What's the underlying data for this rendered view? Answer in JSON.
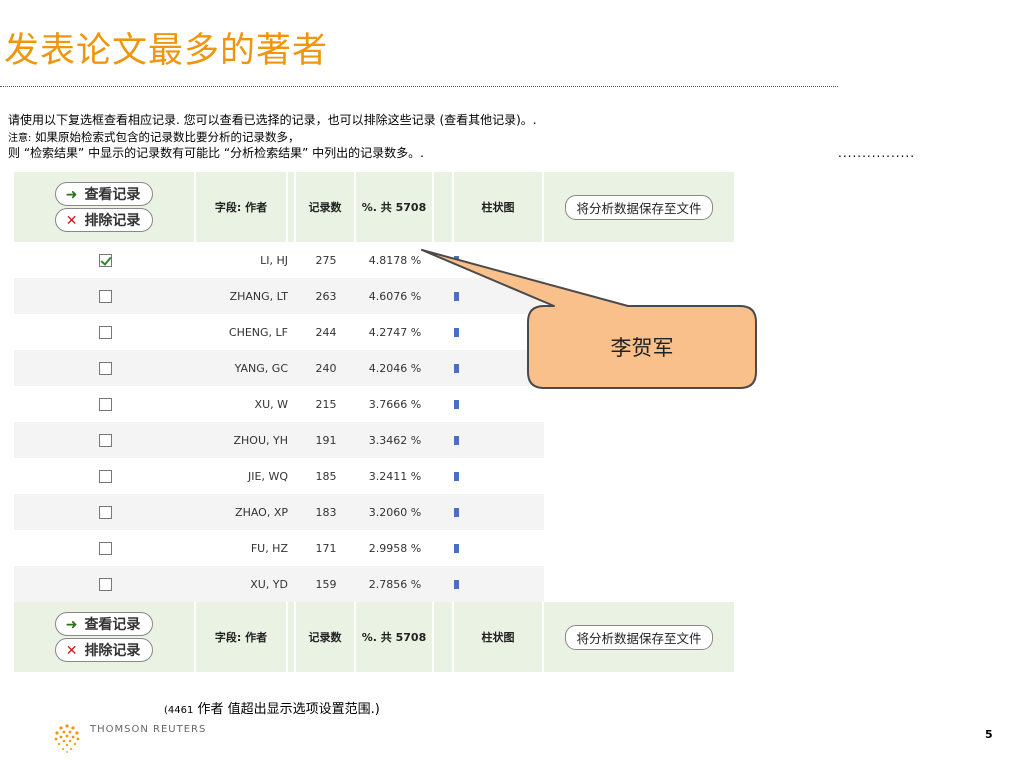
{
  "page": {
    "title": "发表论文最多的著者",
    "page_number": "5"
  },
  "instructions": {
    "line1": "请使用以下复选框查看相应记录. 您可以查看已选择的记录，也可以排除这些记录 (查看其他记录)。.",
    "line2_label": "注意:",
    "line2": "如果原始检索式包含的记录数比要分析的记录数多，",
    "line3": "则 “检索结果” 中显示的记录数有可能比 “分析检索结果” 中列出的记录数多。.",
    "trailing_dots": "................"
  },
  "table": {
    "buttons": {
      "view_label": "查看记录",
      "exclude_label": "排除记录",
      "save_label": "将分析数据保存至文件"
    },
    "headers": {
      "field": "字段: 作者",
      "count": "记录数",
      "percent": "%. 共 5708",
      "bar": "柱状图"
    },
    "rows": [
      {
        "checked": true,
        "author": "LI, HJ",
        "count": "275",
        "percent": "4.8178 %"
      },
      {
        "checked": false,
        "author": "ZHANG, LT",
        "count": "263",
        "percent": "4.6076 %"
      },
      {
        "checked": false,
        "author": "CHENG, LF",
        "count": "244",
        "percent": "4.2747 %"
      },
      {
        "checked": false,
        "author": "YANG, GC",
        "count": "240",
        "percent": "4.2046 %"
      },
      {
        "checked": false,
        "author": "XU, W",
        "count": "215",
        "percent": "3.7666 %"
      },
      {
        "checked": false,
        "author": "ZHOU, YH",
        "count": "191",
        "percent": "3.3462 %"
      },
      {
        "checked": false,
        "author": "JIE, WQ",
        "count": "185",
        "percent": "3.2411 %"
      },
      {
        "checked": false,
        "author": "ZHAO, XP",
        "count": "183",
        "percent": "3.2060 %"
      },
      {
        "checked": false,
        "author": "FU, HZ",
        "count": "171",
        "percent": "2.9958 %"
      },
      {
        "checked": false,
        "author": "XU, YD",
        "count": "159",
        "percent": "2.7856 %"
      }
    ],
    "footnote_count": "(4461",
    "footnote_text": "作者 值超出显示选项设置范围.)"
  },
  "callout": {
    "label": "李贺军",
    "fill": "#f9c08c",
    "stroke": "#4a4a4a"
  },
  "footer": {
    "logo_text": "THOMSON REUTERS"
  },
  "colors": {
    "title": "#f0960e",
    "header_bg": "#e9f2e3",
    "bar": "#4a6fc0",
    "checkmark": "#2a8a2a",
    "exclude_icon": "#d01a1a",
    "view_icon": "#2f6f1c"
  },
  "icons": [
    "arrow-right-icon",
    "x-icon",
    "checkbox-icon",
    "bar-icon",
    "thomson-reuters-logo-icon"
  ]
}
